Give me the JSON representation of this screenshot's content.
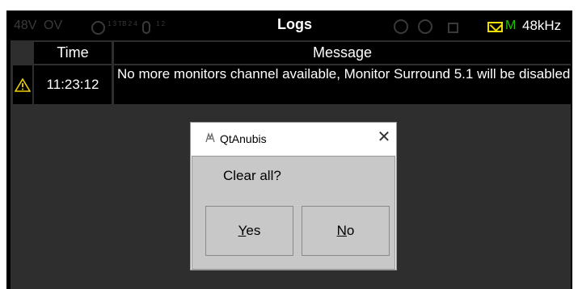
{
  "statusbar": {
    "phantom_power": "48V",
    "overload": "OV",
    "routing_mini": "1 3 TB 2 4",
    "mic_mini": "1 2",
    "title": "Logs",
    "mail_icon": "envelope-icon",
    "mode": "M",
    "sample_rate": "48kHz",
    "colors": {
      "mail": "#f0e000",
      "mode": "#22c000"
    }
  },
  "table": {
    "columns": [
      "Time",
      "Message"
    ],
    "rows": [
      {
        "icon": "warning-icon",
        "time": "11:23:12",
        "message": "No more monitors channel available, Monitor  Surround 5.1 will be disabled"
      }
    ]
  },
  "dialog": {
    "title": "QtAnubis",
    "message": "Clear all?",
    "yes_label": "Yes",
    "no_label": "No"
  }
}
